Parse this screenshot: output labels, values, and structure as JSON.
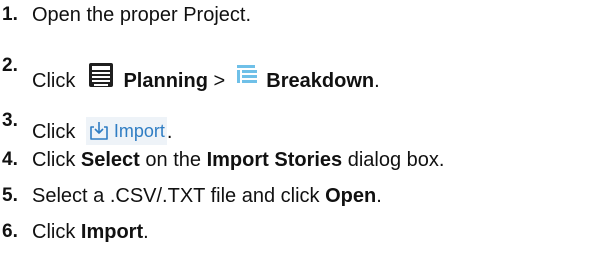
{
  "steps": [
    {
      "number": "1.",
      "text": "Open the proper Project."
    },
    {
      "number": "2.",
      "prefix": "Click",
      "planning": "Planning",
      "separator": ">",
      "breakdown": "Breakdown",
      "suffix": ".",
      "planning_icon": "planning-icon",
      "breakdown_icon": "breakdown-icon"
    },
    {
      "number": "3.",
      "prefix": "Click",
      "import_button": "Import",
      "import_icon": "import-icon",
      "suffix": "."
    },
    {
      "number": "4.",
      "prefix": "Click",
      "select": "Select",
      "middle": "on the",
      "dialog": "Import Stories",
      "suffix": "dialog box."
    },
    {
      "number": "5.",
      "prefix": "Select a .CSV/.TXT file and click",
      "open": "Open",
      "suffix": "."
    },
    {
      "number": "6.",
      "prefix": "Click",
      "import": "Import",
      "suffix": "."
    }
  ],
  "colors": {
    "text": "#111111",
    "import_link": "#2f7dc3",
    "breakdown_icon": "#6fc0e8",
    "planning_icon": "#1f1f1f"
  }
}
